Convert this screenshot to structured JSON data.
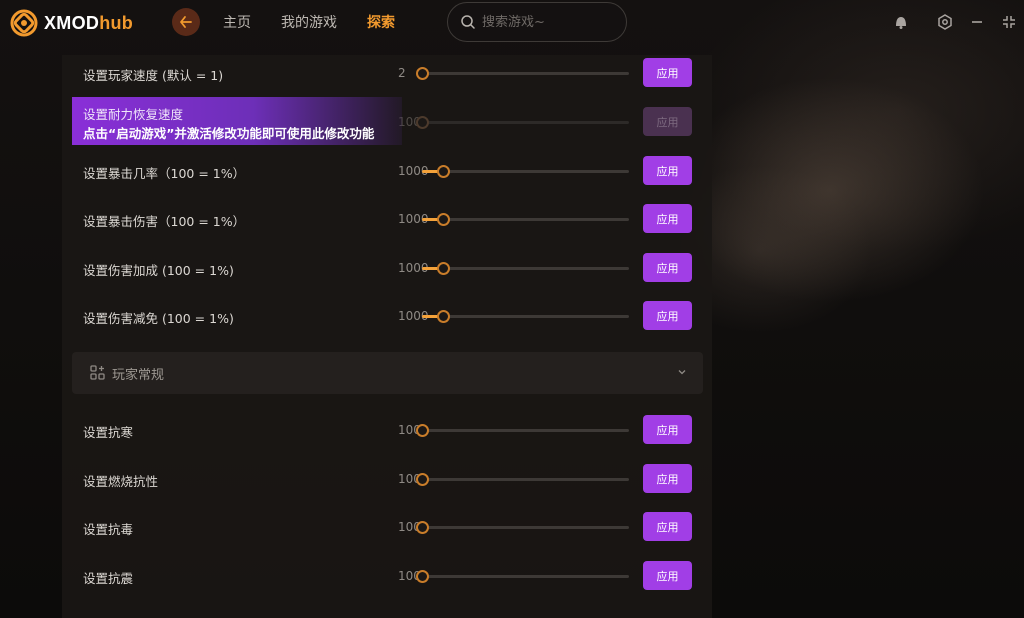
{
  "app": {
    "logo_text_main": "XMOD",
    "logo_text_accent": "hub"
  },
  "nav": {
    "items": [
      {
        "label": "主页",
        "active": false
      },
      {
        "label": "我的游戏",
        "active": false
      },
      {
        "label": "探索",
        "active": true
      }
    ]
  },
  "search": {
    "placeholder": "搜索游戏~",
    "value": ""
  },
  "window_controls": [
    "notification-bell-icon",
    "settings-hex-icon",
    "minimize-icon",
    "fullscreen-icon"
  ],
  "tooltip": {
    "title": "设置耐力恢复速度",
    "message": "点击“启动游戏”并激活修改功能即可使用此修改功能"
  },
  "rows_group1": [
    {
      "label": "设置玩家速度 (默认 = 1)",
      "value": "2",
      "fraction": 0.0,
      "apply": "应用",
      "disabled": false
    },
    {
      "label": "",
      "value": "100",
      "fraction": 0.0,
      "apply": "应用",
      "disabled": true
    },
    {
      "label": "设置暴击几率（100 = 1%）",
      "value": "1000",
      "fraction": 0.1,
      "apply": "应用",
      "disabled": false
    },
    {
      "label": "设置暴击伤害（100 = 1%）",
      "value": "1000",
      "fraction": 0.1,
      "apply": "应用",
      "disabled": false
    },
    {
      "label": "设置伤害加成 (100 = 1%)",
      "value": "1000",
      "fraction": 0.1,
      "apply": "应用",
      "disabled": false
    },
    {
      "label": "设置伤害减免 (100 = 1%)",
      "value": "1000",
      "fraction": 0.1,
      "apply": "应用",
      "disabled": false
    }
  ],
  "section": {
    "title": "玩家常规"
  },
  "rows_group2": [
    {
      "label": "设置抗寒",
      "value": "100",
      "fraction": 0.0,
      "apply": "应用"
    },
    {
      "label": "设置燃烧抗性",
      "value": "100",
      "fraction": 0.0,
      "apply": "应用"
    },
    {
      "label": "设置抗毒",
      "value": "100",
      "fraction": 0.0,
      "apply": "应用"
    },
    {
      "label": "设置抗震",
      "value": "100",
      "fraction": 0.0,
      "apply": "应用"
    }
  ],
  "colors": {
    "accent_orange": "#f29a2e",
    "apply_purple": "#a13ee6",
    "tooltip_purple": "#8a2fd8"
  }
}
